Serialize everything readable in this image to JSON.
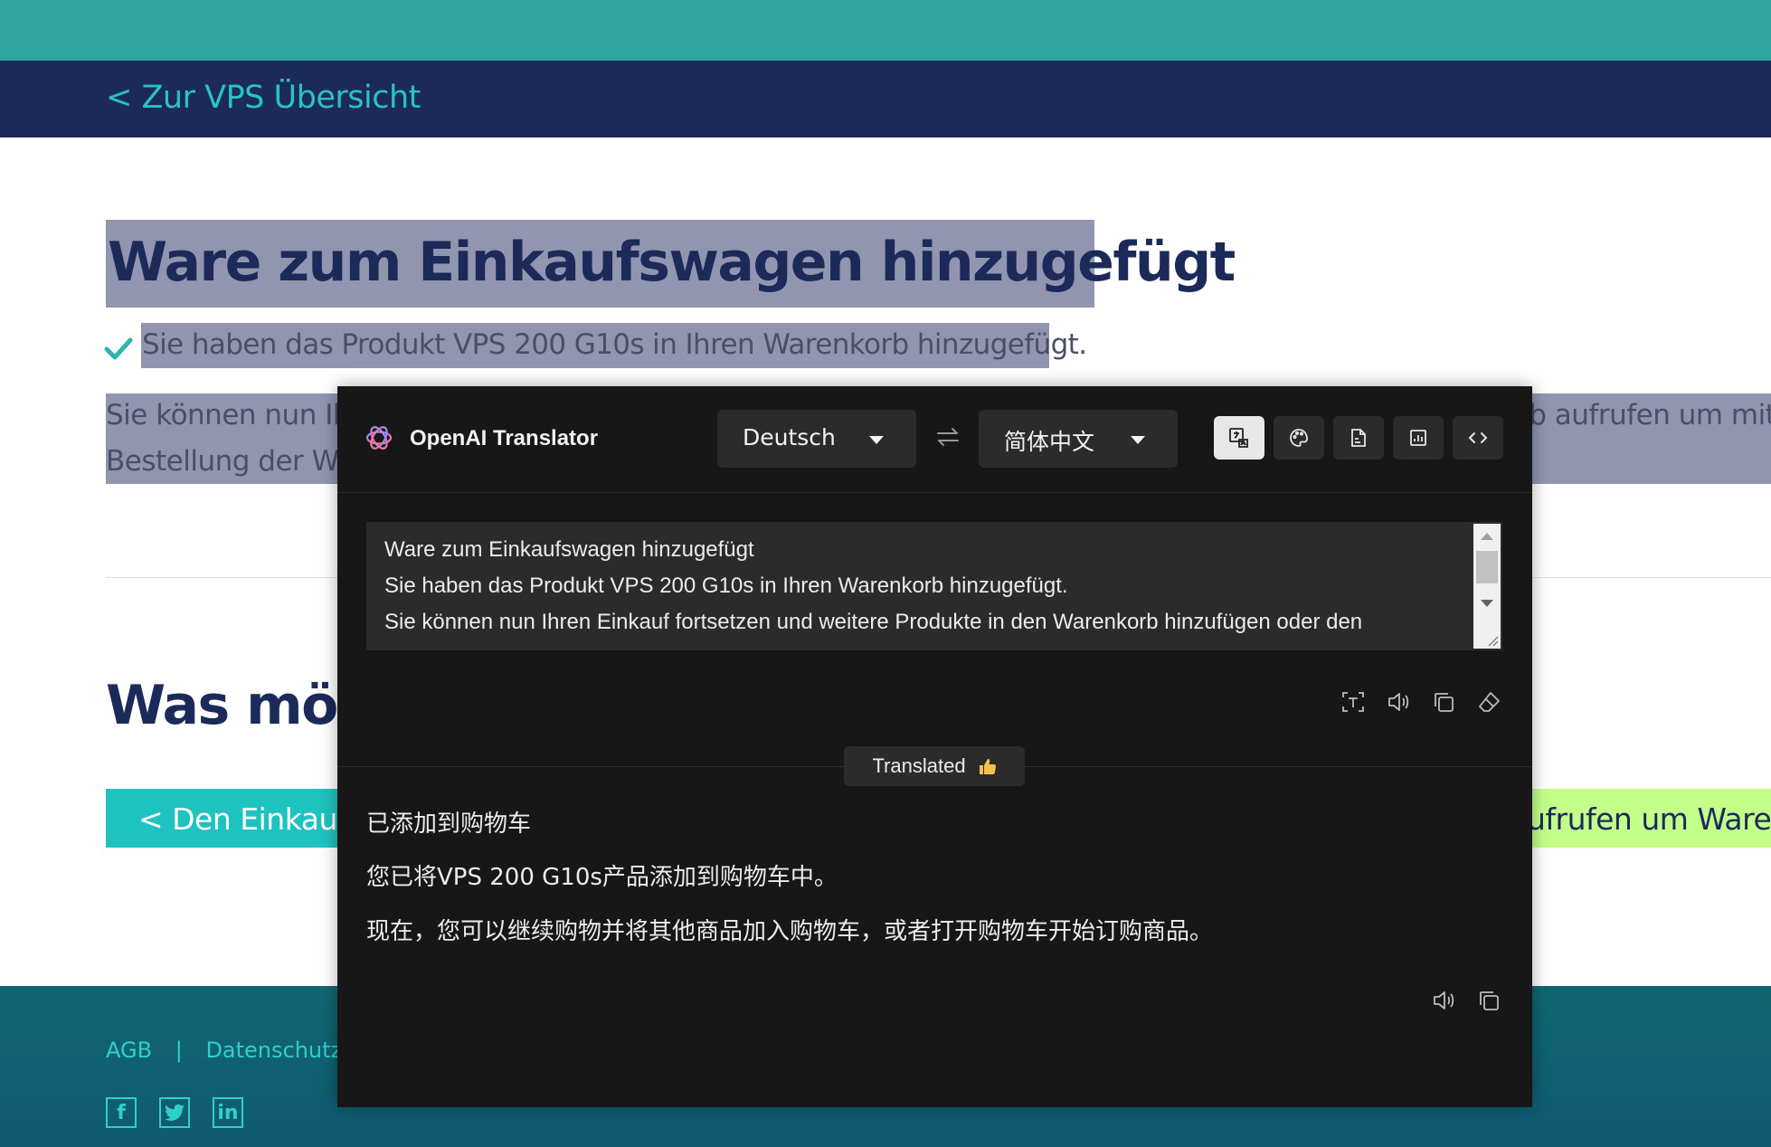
{
  "page": {
    "back_link": "< Zur VPS Übersicht",
    "title": "Ware zum Einkaufswagen hinzugefügt",
    "added_line": "Sie haben das Produkt VPS 200 G10s in Ihren Warenkorb hinzugefügt.",
    "para_line1_left": "Sie können nun Ih",
    "para_line1_right": "rb aufrufen um mit",
    "para_line2_left": "Bestellung der Wa",
    "question_heading": "Was möc",
    "continue_button": "< Den Einkauf fo",
    "checkout_button": "ufrufen um Ware zu",
    "footer": {
      "links": [
        "AGB",
        "|",
        "Datenschutz",
        "|"
      ],
      "social": [
        "facebook-icon",
        "twitter-icon",
        "linkedin-icon"
      ]
    },
    "colors": {
      "top_strip": "#2fa5a0",
      "navbar": "#1c2a5a",
      "accent": "#1ec3c0",
      "highlight": "#9195b0",
      "checkout_green": "#c4ff8a"
    }
  },
  "translator": {
    "brand": "OpenAI Translator",
    "source_lang": "Deutsch",
    "target_lang": "简体中文",
    "modes": [
      "translate-mode-icon",
      "polish-icon",
      "summarize-icon",
      "analyze-icon",
      "code-explain-icon"
    ],
    "input_lines": [
      "Ware zum Einkaufswagen hinzugefügt",
      "Sie haben das Produkt VPS 200 G10s in Ihren Warenkorb hinzugefügt.",
      "Sie können nun Ihren Einkauf fortsetzen und weitere Produkte in den Warenkorb hinzufügen oder den"
    ],
    "status_badge": "Translated",
    "output_lines": [
      "已添加到购物车",
      "您已将VPS 200 G10s产品添加到购物车中。",
      "现在，您可以继续购物并将其他商品加入购物车，或者打开购物车开始订购商品。"
    ]
  }
}
